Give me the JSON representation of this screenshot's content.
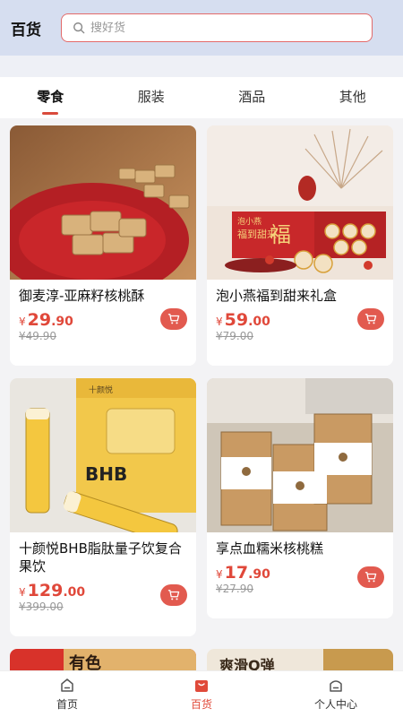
{
  "header": {
    "title": "百货",
    "search_placeholder": "搜好货"
  },
  "tabs": [
    {
      "label": "零食",
      "active": true
    },
    {
      "label": "服装",
      "active": false
    },
    {
      "label": "酒品",
      "active": false
    },
    {
      "label": "其他",
      "active": false
    }
  ],
  "products": [
    {
      "title": "御麦淳-亚麻籽核桃酥",
      "currency": "¥",
      "price_int": "29",
      "price_dec": ".90",
      "old_price": "¥49.90"
    },
    {
      "title": "泡小燕福到甜来礼盒",
      "currency": "¥",
      "price_int": "59",
      "price_dec": ".00",
      "old_price": "¥79.00"
    },
    {
      "title": "十颜悦BHB脂肽量子饮复合果饮",
      "currency": "¥",
      "price_int": "129",
      "price_dec": ".00",
      "old_price": "¥399.00"
    },
    {
      "title": "享点血糯米核桃糕",
      "currency": "¥",
      "price_int": "17",
      "price_dec": ".90",
      "old_price": "¥27.90"
    }
  ],
  "image_text": {
    "gift_box_brand": "泡小燕",
    "gift_box_text": "福到甜来",
    "gift_box_fu": "福",
    "bhb_brand": "十颜悦",
    "bhb_label": "BHB",
    "card5_text": "有色",
    "card6_text": "爽滑Q弹"
  },
  "bottom_nav": [
    {
      "label": "首页",
      "active": false,
      "icon": "home-icon"
    },
    {
      "label": "百货",
      "active": true,
      "icon": "shopping-bag-icon"
    },
    {
      "label": "个人中心",
      "active": false,
      "icon": "user-icon"
    }
  ],
  "colors": {
    "accent": "#e0483a",
    "header_bg": "#d6def0",
    "search_border": "#e36a6a"
  }
}
